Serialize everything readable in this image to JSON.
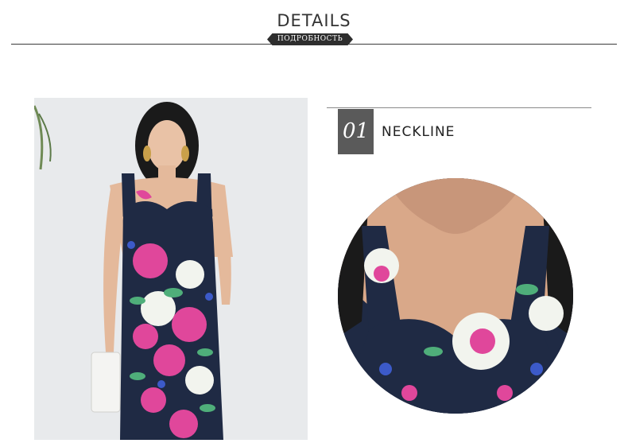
{
  "header": {
    "title": "DETAILS",
    "subtitle": "ПОДРОБНОСТЬ"
  },
  "section": {
    "number": "01",
    "label": "NECKLINE"
  },
  "images": {
    "model_photo": "model-in-floral-dress-photo",
    "detail_photo": "neckline-closeup-photo"
  },
  "colors": {
    "dress_navy": "#1f2a44",
    "flower_pink": "#e0479b",
    "flower_white": "#f2f4ee",
    "leaf_green": "#4fae7a",
    "badge_dark": "#2e2e2e",
    "number_box": "#5a5a5a"
  }
}
